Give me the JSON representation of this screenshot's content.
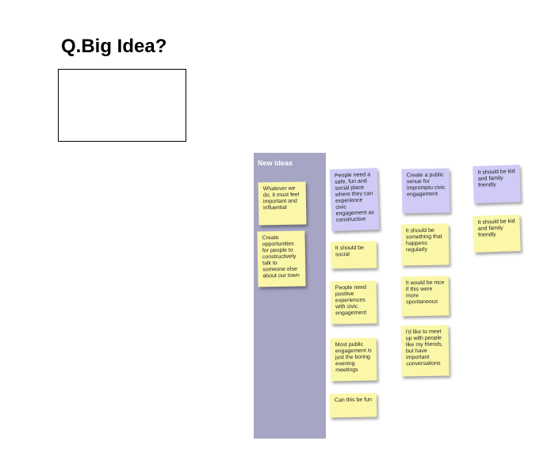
{
  "heading": {
    "title": "Q.Big Idea?"
  },
  "column": {
    "title": "New ideas"
  },
  "colors": {
    "column_bg": "#a6a5c4",
    "note_yellow": "#fbf7a9",
    "note_purple": "#cfcbf6"
  },
  "notes": [
    {
      "text": "Whatever we do, it must feel important and influential",
      "color": "yellow"
    },
    {
      "text": "Create opportunities for people to constructively talk to someone else about our town",
      "color": "yellow"
    },
    {
      "text": "People need a safe, fun and social place where they can experience civic engagement as constructive",
      "color": "purple"
    },
    {
      "text": "It should be social",
      "color": "yellow"
    },
    {
      "text": "People need positive experiences with civic engagement",
      "color": "yellow"
    },
    {
      "text": "Most public engagement is just the boring evening meetings",
      "color": "yellow"
    },
    {
      "text": "Can this be fun",
      "color": "yellow"
    },
    {
      "text": "Create a public venue for impromptu civic engagement",
      "color": "purple"
    },
    {
      "text": "It should be something that happens regularly",
      "color": "yellow"
    },
    {
      "text": "It would be nice if this were more spontaneous",
      "color": "yellow"
    },
    {
      "text": "I'd like to meet up with people like my friends, but have important conversations",
      "color": "yellow"
    },
    {
      "text": "It should be kid and family friendly",
      "color": "purple"
    },
    {
      "text": "It should be kid and family friendly",
      "color": "yellow"
    }
  ]
}
